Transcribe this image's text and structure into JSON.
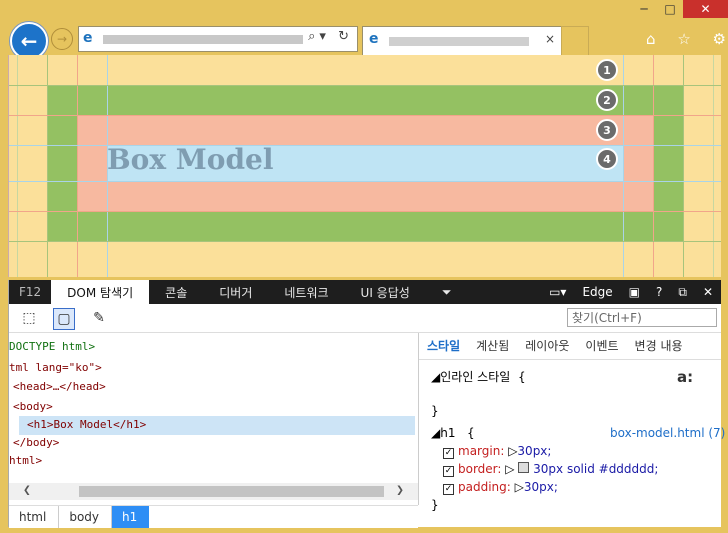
{
  "window": {
    "controls": [
      "─",
      "□",
      "✕"
    ]
  },
  "nav": {
    "back_glyph": "←",
    "forward_glyph": "→",
    "address_tools": "⌕▾ ↻",
    "tab_close": "×",
    "toolbar_icons": [
      "⌂",
      "☆",
      "⚙"
    ]
  },
  "page": {
    "heading": "Box Model",
    "markers": [
      "1",
      "2",
      "3",
      "4"
    ],
    "colors": {
      "margin": "#fbe09a",
      "border": "#94c162",
      "padding": "#f7b9a0",
      "content": "#bfe4f4"
    }
  },
  "devtools": {
    "tabs": [
      "F12",
      "DOM 탐색기",
      "콘솔",
      "디버거",
      "네트워크",
      "UI 응답성"
    ],
    "active_tab": "DOM 탐색기",
    "right": {
      "emulation_label": "Edge",
      "help": "?",
      "undock": "⧉",
      "close": "✕"
    },
    "find_placeholder": "찾기(Ctrl+F)",
    "dom_lines": [
      {
        "text": "DOCTYPE html>",
        "kind": "doc"
      },
      {
        "text": "tml lang=\"ko\">",
        "kind": "tag"
      },
      {
        "text": "<head>…</head>",
        "kind": "tag"
      },
      {
        "text": "<body>",
        "kind": "tag"
      },
      {
        "text": "<h1>Box Model</h1>",
        "kind": "tag"
      },
      {
        "text": "</body>",
        "kind": "tag"
      },
      {
        "text": "html>",
        "kind": "tag"
      }
    ],
    "breadcrumb": [
      "html",
      "body",
      "h1"
    ],
    "style_tabs": [
      "스타일",
      "계산됨",
      "레이아웃",
      "이벤트",
      "변경 내용"
    ],
    "styles": {
      "inline_label": "인라인 스타일",
      "inline_brace_open": "{",
      "inline_brace_close": "}",
      "font_glyph": "a:",
      "rule_selector": "h1",
      "rule_brace_open": "{",
      "rule_brace_close": "}",
      "rule_source": "box-model.html (7)",
      "properties": [
        {
          "name": "margin:",
          "value": "30px;"
        },
        {
          "name": "border:",
          "value": "30px solid #dddddd;"
        },
        {
          "name": "padding:",
          "value": "30px;"
        }
      ]
    }
  }
}
